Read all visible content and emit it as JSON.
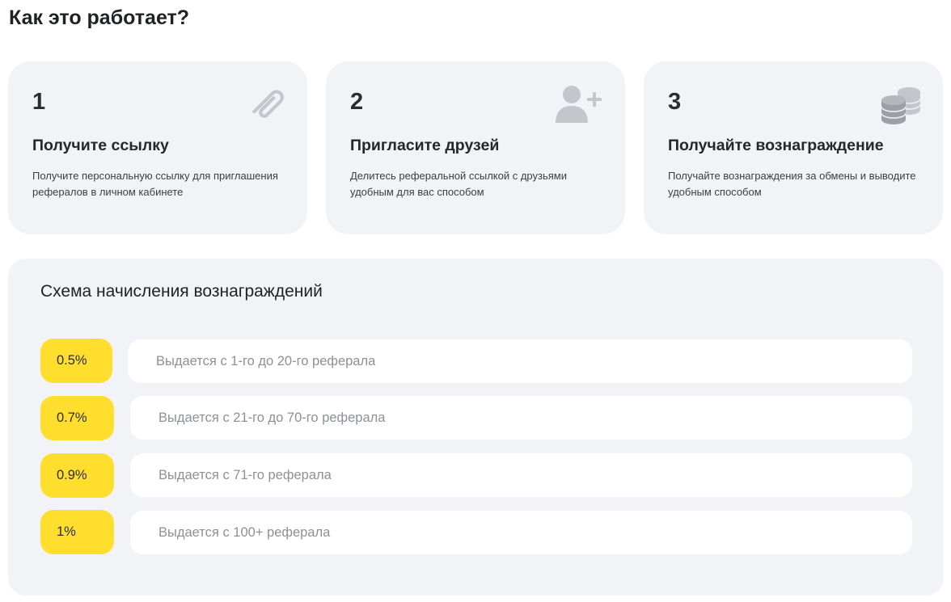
{
  "page_title": "Как это работает?",
  "steps": [
    {
      "number": "1",
      "title": "Получите ссылку",
      "description": "Получите персональную ссылку для приглашения рефералов в личном кабинете",
      "icon": "paperclip-icon"
    },
    {
      "number": "2",
      "title": "Пригласите друзей",
      "description": "Делитесь реферальной ссылкой с друзьями удобным для вас способом",
      "icon": "add-user-icon"
    },
    {
      "number": "3",
      "title": "Получайте вознаграждение",
      "description": "Получайте вознаграждения за обмены и выводите удобным способом",
      "icon": "coins-icon"
    }
  ],
  "scheme": {
    "title": "Схема начисления вознаграждений",
    "tiers": [
      {
        "rate": "0.5%",
        "description": "Выдается с 1-го до 20-го реферала"
      },
      {
        "rate": "0.7%",
        "description": "Выдается с 21-го до 70-го реферала"
      },
      {
        "rate": "0.9%",
        "description": "Выдается с 71-го реферала"
      },
      {
        "rate": "1%",
        "description": "Выдается с 100+ реферала"
      }
    ]
  },
  "colors": {
    "card_background": "#f2f3f6",
    "accent_yellow": "#ffde2e",
    "icon_gray": "#c4c6cb",
    "muted_text": "#8c9097"
  }
}
